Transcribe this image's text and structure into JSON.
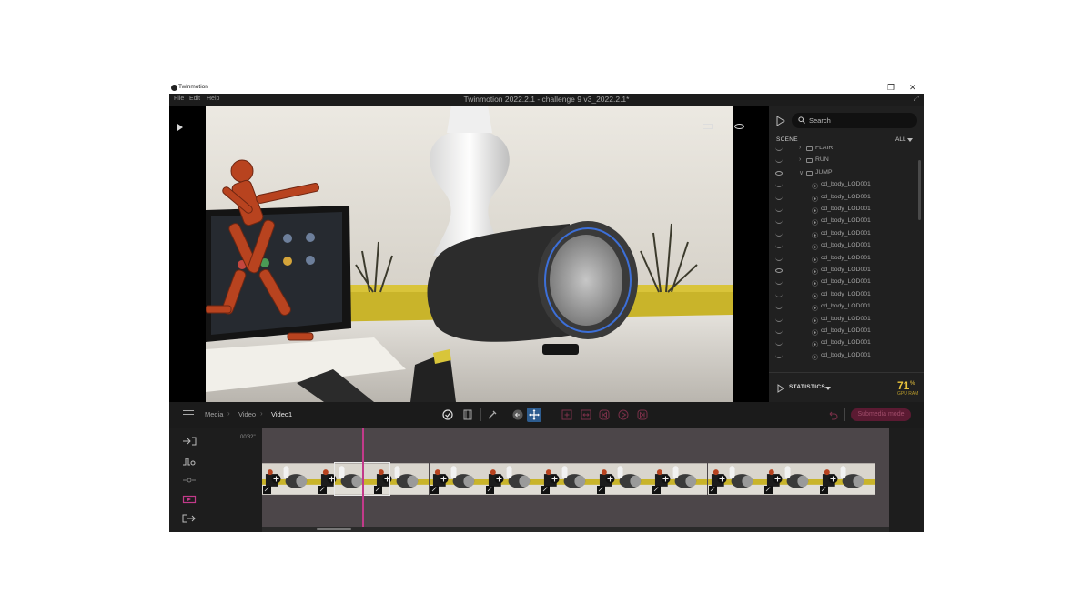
{
  "os": {
    "app_name": "Twinmotion",
    "restore_icon": "restore-icon",
    "close_icon": "close-icon"
  },
  "menu": {
    "items": [
      "File",
      "Edit",
      "Help"
    ],
    "title": "Twinmotion 2022.2.1 - challenge 9 v3_2022.2.1*",
    "expand_icon": "expand-icon"
  },
  "scene": {
    "search_placeholder": "Search",
    "label": "SCENE",
    "filter": "ALL",
    "tree": [
      {
        "kind": "folder",
        "label": "FLAIR",
        "visible": false
      },
      {
        "kind": "folder",
        "label": "RUN",
        "visible": false
      },
      {
        "kind": "folder-open",
        "label": "JUMP",
        "visible": true
      },
      {
        "kind": "object",
        "label": "cd_body_LOD001",
        "visible": false
      },
      {
        "kind": "object",
        "label": "cd_body_LOD001",
        "visible": false
      },
      {
        "kind": "object",
        "label": "cd_body_LOD001",
        "visible": false
      },
      {
        "kind": "object",
        "label": "cd_body_LOD001",
        "visible": false
      },
      {
        "kind": "object",
        "label": "cd_body_LOD001",
        "visible": false
      },
      {
        "kind": "object",
        "label": "cd_body_LOD001",
        "visible": false
      },
      {
        "kind": "object",
        "label": "cd_body_LOD001",
        "visible": false
      },
      {
        "kind": "object",
        "label": "cd_body_LOD001",
        "visible": true
      },
      {
        "kind": "object",
        "label": "cd_body_LOD001",
        "visible": false
      },
      {
        "kind": "object",
        "label": "cd_body_LOD001",
        "visible": false
      },
      {
        "kind": "object",
        "label": "cd_body_LOD001",
        "visible": false
      },
      {
        "kind": "object",
        "label": "cd_body_LOD001",
        "visible": false
      },
      {
        "kind": "object",
        "label": "cd_body_LOD001",
        "visible": false
      },
      {
        "kind": "object",
        "label": "cd_body_LOD001",
        "visible": false
      },
      {
        "kind": "object",
        "label": "cd_body_LOD001",
        "visible": false
      }
    ],
    "statistics_label": "STATISTICS",
    "gpu_value": "71",
    "gpu_unit": "%",
    "gpu_label": "GPU RAM"
  },
  "toolbar": {
    "breadcrumb": [
      "Media",
      "Video",
      "Video1"
    ],
    "submode_label": "Submedia mode",
    "accent": "#c23a8a",
    "active_tool_color": "#2d5c8f"
  },
  "timeline": {
    "time_label": "00'32\"",
    "clip_count": 11
  }
}
